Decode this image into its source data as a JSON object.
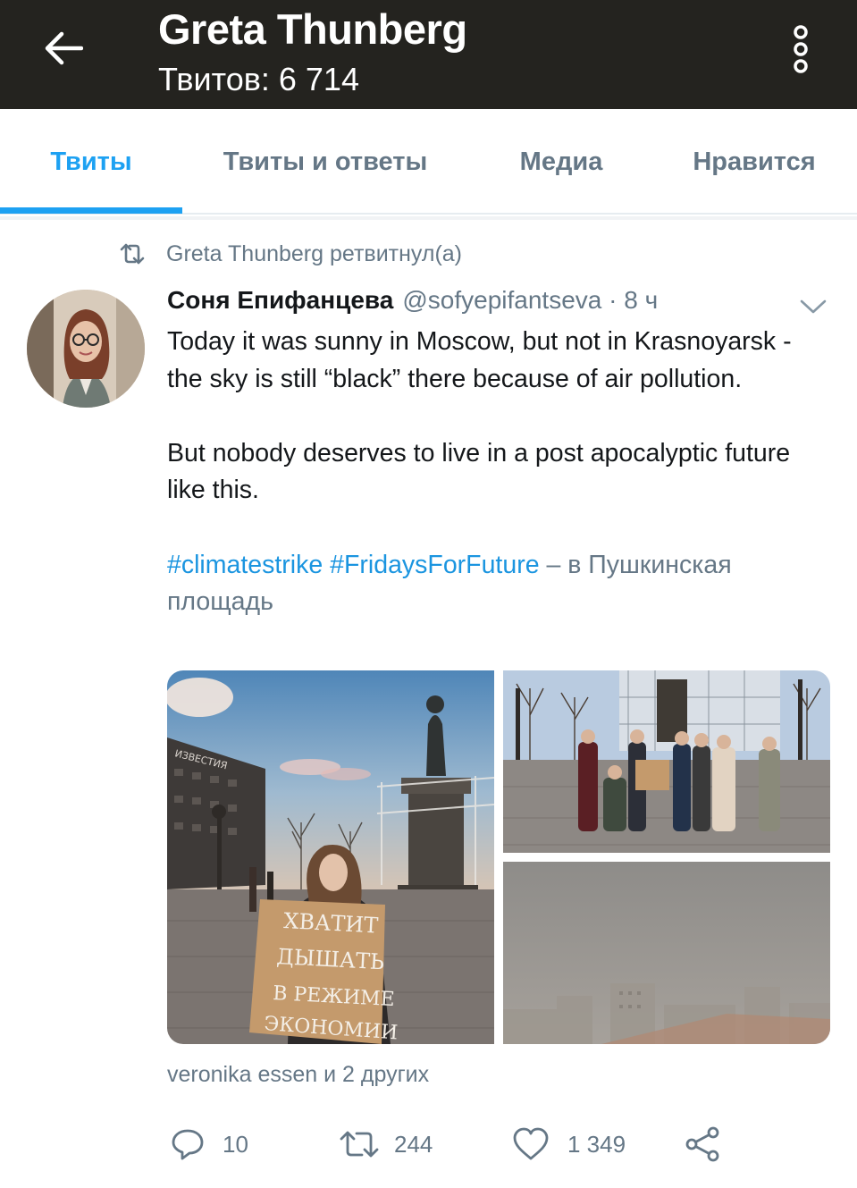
{
  "header": {
    "title": "Greta Thunberg",
    "subtitle": "Твитов: 6 714",
    "back_icon": "arrow-left-icon",
    "more_icon": "more-vertical-icon",
    "background": "#24231f"
  },
  "tabs": [
    {
      "label": "Твиты",
      "active": true
    },
    {
      "label": "Твиты и ответы",
      "active": false
    },
    {
      "label": "Медиа",
      "active": false
    },
    {
      "label": "Нравится",
      "active": false
    }
  ],
  "accent_color": "#1da1f2",
  "tweet": {
    "retweet_label": "Greta Thunberg ретвитнул(а)",
    "author_name": "Соня Епифанцева",
    "author_handle": "@sofyepifantseva · 8 ч",
    "text_p1": "Today it was sunny in Moscow, but not in Krasnoyarsk - the sky is still “black” there because of air pollution.",
    "text_p2": "But nobody deserves to live in a post apocalyptic future like this.",
    "hashtag1": "#climatestrike",
    "hashtag2": "#FridaysForFuture",
    "location": "– в Пушкинская площадь",
    "media": {
      "sign_lines": [
        "ХВАТИТ",
        "ДЫШАТЬ",
        "В РЕЖИМЕ",
        "ЭКОНОМИИ"
      ],
      "building_sign": "ИЗВЕСТИЯ"
    },
    "liked_by": "veronika essen и 2 других",
    "counts": {
      "replies": "10",
      "retweets": "244",
      "likes": "1 349"
    }
  }
}
